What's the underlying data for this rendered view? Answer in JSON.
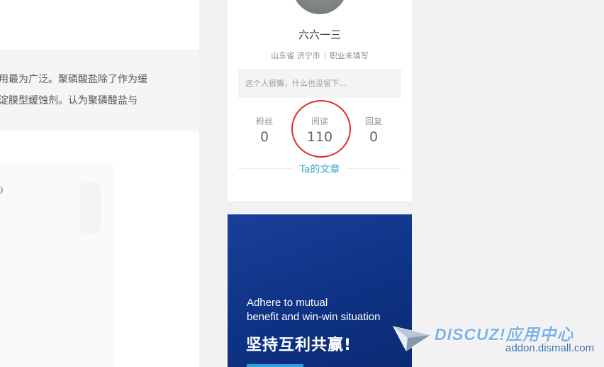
{
  "article": {
    "quote_line1": "胺作为水处理剂时应用最为广泛。聚磷酸盐除了作为缓",
    "quote_line2": "蚀剂，还被认为是沉淀膜型缓蚀剂。认为聚磷酸盐与"
  },
  "profile": {
    "username": "六六一三",
    "location": "山东省 济宁市",
    "occupation": "职业未填写",
    "bio_placeholder": "这个人很懒，什么也没留下...",
    "stats": [
      {
        "label": "粉丝",
        "value": "0"
      },
      {
        "label": "阅读",
        "value": "110"
      },
      {
        "label": "回复",
        "value": "0"
      }
    ],
    "articles_link": "Ta的文章",
    "highlight_color": "#e02a2a",
    "link_color": "#3aa3c9"
  },
  "banner": {
    "en_line1": "Adhere to mutual",
    "en_line2": "benefit and win-win situation",
    "cn_slogan": "坚持互利共赢!",
    "bg_color": "#103588",
    "accent_color": "#2da0e0"
  },
  "watermark": {
    "brand": "DISCUZ!应用中心",
    "domain": "addon.dismall.com",
    "icon": "paper-plane-icon"
  }
}
